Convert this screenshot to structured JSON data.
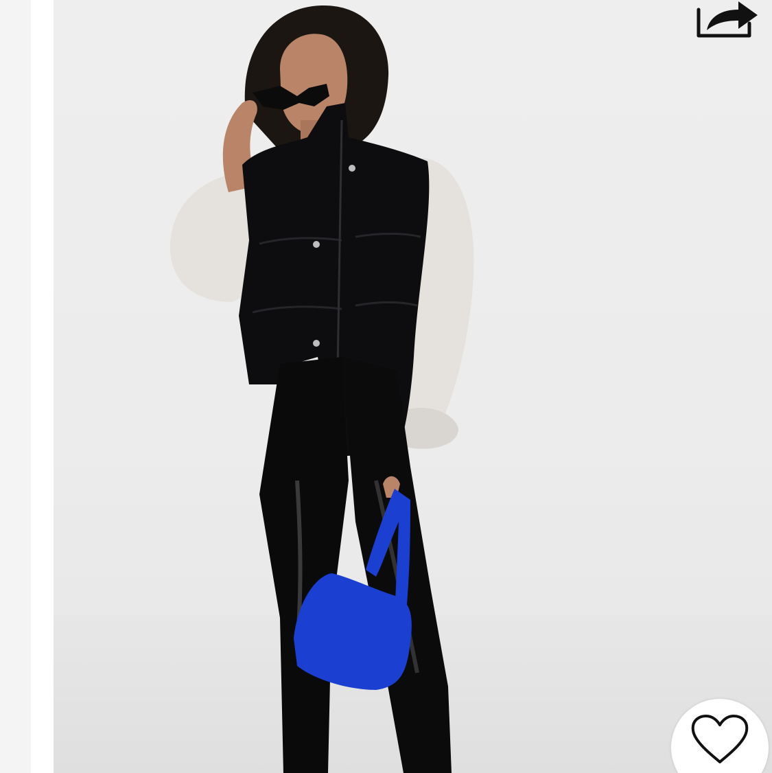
{
  "product_image": {
    "subject": "model-in-black-puffer-vest",
    "colors": {
      "vest": "#0d0d0f",
      "sweater": "#e4e1dc",
      "pants": "#0a0a0a",
      "bag": "#1a3fd1",
      "background": "#ececec"
    }
  },
  "actions": {
    "share_icon": "share-arrow-icon",
    "favorite_icon": "heart-outline-icon"
  }
}
